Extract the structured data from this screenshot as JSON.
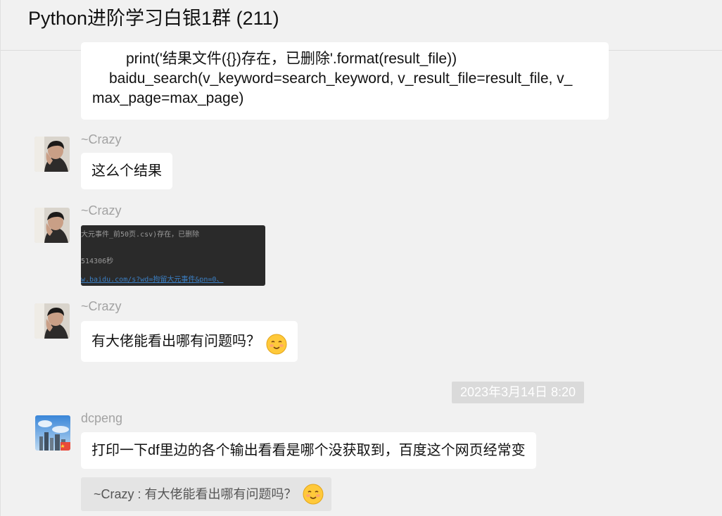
{
  "header": {
    "title": "Python进阶学习白银1群 (211)"
  },
  "code_message": {
    "lines": [
      "print('结果文件({})存在，已删除'.format(result_file))",
      "baidu_search(v_keyword=search_keyword, v_result_file=result_file, v_",
      "max_page=max_page)"
    ]
  },
  "messages": [
    {
      "sender": "~Crazy",
      "text": "这么个结果"
    },
    {
      "sender": "~Crazy",
      "image_lines": [
        "大元事件_前50页.csv)存在，已删除",
        "514306秒",
        "w.baidu.com/s?wd=拘留大元事件&pn=0、"
      ]
    },
    {
      "sender": "~Crazy",
      "text": "有大佬能看出哪有问题吗？",
      "emoji": "smiling-face-icon"
    },
    {
      "sender": "dcpeng",
      "text": "打印一下df里边的各个输出看看是哪个没获取到，百度这个网页经常变"
    }
  ],
  "timestamp": "2023年3月14日 8:20",
  "quote": {
    "text": "~Crazy : 有大佬能看出哪有问题吗？",
    "emoji": "smiling-face-icon"
  },
  "colors": {
    "background": "#f1f1f1",
    "bubble": "#ffffff",
    "sender_name": "#a3a3a3",
    "timestamp_bg": "#dadada"
  }
}
